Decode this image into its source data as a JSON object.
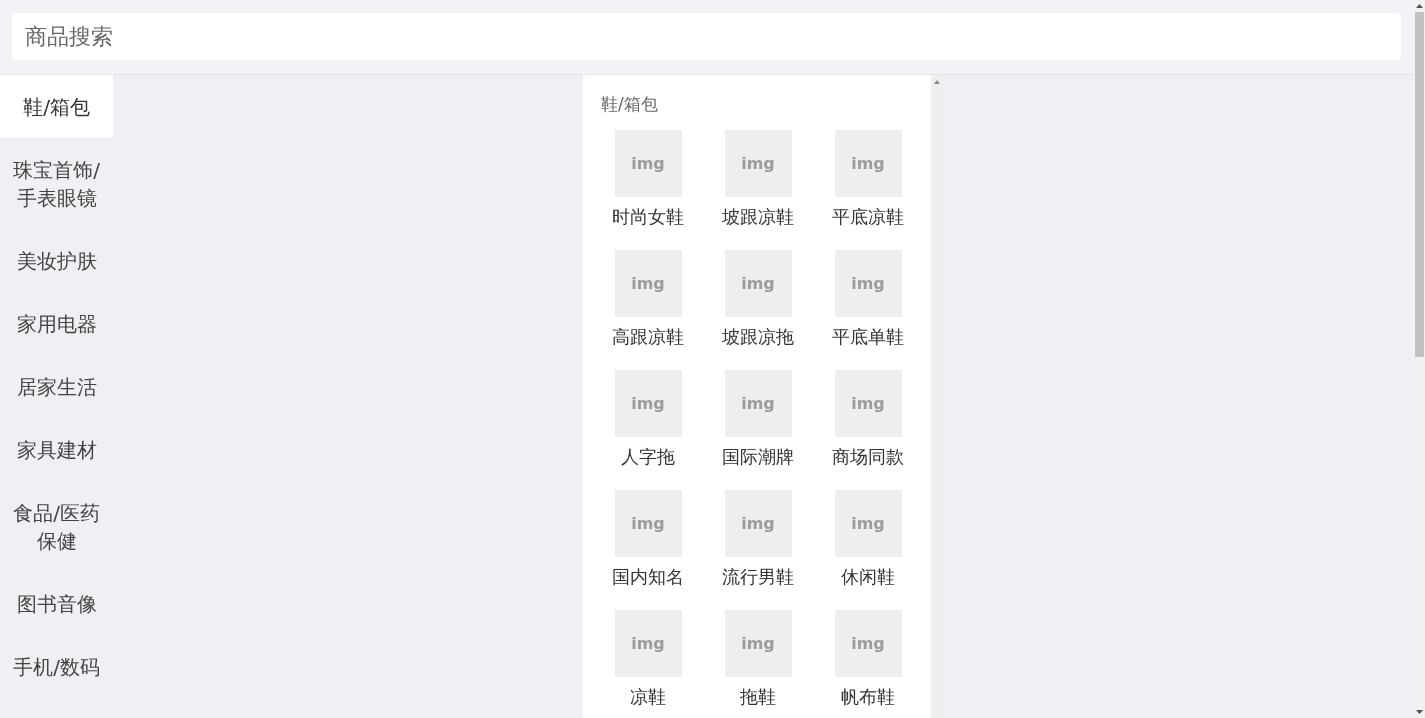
{
  "search": {
    "placeholder": "商品搜索"
  },
  "sidebar": {
    "items": [
      {
        "label": "鞋/箱包",
        "selected": true
      },
      {
        "label": "珠宝首饰/手表眼镜",
        "selected": false
      },
      {
        "label": "美妆护肤",
        "selected": false
      },
      {
        "label": "家用电器",
        "selected": false
      },
      {
        "label": "居家生活",
        "selected": false
      },
      {
        "label": "家具建材",
        "selected": false
      },
      {
        "label": "食品/医药保健",
        "selected": false
      },
      {
        "label": "图书音像",
        "selected": false
      },
      {
        "label": "手机/数码",
        "selected": false
      }
    ]
  },
  "panel": {
    "title": "鞋/箱包",
    "products": [
      {
        "image_text": "img",
        "label": "时尚女鞋"
      },
      {
        "image_text": "img",
        "label": "坡跟凉鞋"
      },
      {
        "image_text": "img",
        "label": "平底凉鞋"
      },
      {
        "image_text": "img",
        "label": "高跟凉鞋"
      },
      {
        "image_text": "img",
        "label": "坡跟凉拖"
      },
      {
        "image_text": "img",
        "label": "平底单鞋"
      },
      {
        "image_text": "img",
        "label": "人字拖"
      },
      {
        "image_text": "img",
        "label": "国际潮牌"
      },
      {
        "image_text": "img",
        "label": "商场同款"
      },
      {
        "image_text": "img",
        "label": "国内知名"
      },
      {
        "image_text": "img",
        "label": "流行男鞋"
      },
      {
        "image_text": "img",
        "label": "休闲鞋"
      },
      {
        "image_text": "img",
        "label": "凉鞋"
      },
      {
        "image_text": "img",
        "label": "拖鞋"
      },
      {
        "image_text": "img",
        "label": "帆布鞋"
      }
    ]
  }
}
